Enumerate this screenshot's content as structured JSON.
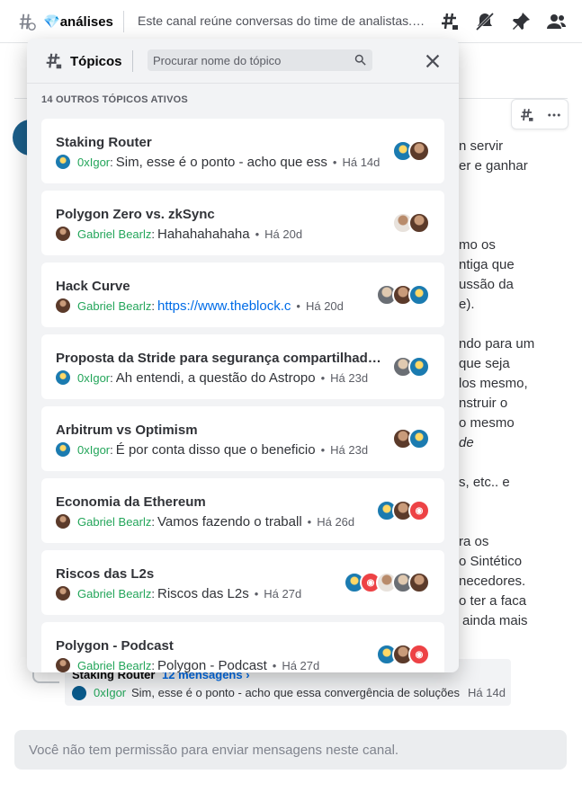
{
  "header": {
    "channel_prefix": "💎",
    "channel_name": "análises",
    "topic": "Este canal reúne conversas do time de analistas. Participe!"
  },
  "background": {
    "lines": [
      "n servir",
      "er e ganhar",
      "mo os",
      "ntiga que",
      "ussão da",
      "e).",
      "ndo para um",
      "que seja",
      "los mesmo,",
      "nstruir o",
      "o mesmo",
      "de",
      "s, etc.. e",
      "ra os",
      "o Sintético",
      "necedores.",
      "o ter a faca",
      "ainda mais"
    ]
  },
  "popup": {
    "title": "Tópicos",
    "search_placeholder": "Procurar nome do tópico",
    "section_label": "14 OUTROS TÓPICOS ATIVOS",
    "threads": [
      {
        "name": "Staking Router",
        "author": "0xIgor",
        "preview": "Sim, esse é o ponto - acho que ess",
        "time": "Há 14d",
        "is_link": false
      },
      {
        "name": "Polygon Zero vs. zkSync",
        "author": "Gabriel Bearlz",
        "preview": "Hahahahahaha",
        "time": "Há 20d",
        "is_link": false
      },
      {
        "name": "Hack Curve",
        "author": "Gabriel Bearlz",
        "preview": "https://www.theblock.c",
        "time": "Há 20d",
        "is_link": true
      },
      {
        "name": "Proposta da Stride para segurança compartilhada...",
        "author": "0xIgor",
        "preview": "Ah entendi, a questão do Astropo",
        "time": "Há 23d",
        "is_link": false
      },
      {
        "name": "Arbitrum vs Optimism",
        "author": "0xIgor",
        "preview": "É por conta disso que o beneficio",
        "time": "Há 23d",
        "is_link": false
      },
      {
        "name": "Economia da Ethereum",
        "author": "Gabriel Bearlz",
        "preview": "Vamos fazendo o traball",
        "time": "Há 26d",
        "is_link": false
      },
      {
        "name": "Riscos das L2s",
        "author": "Gabriel Bearlz",
        "preview": "Riscos das L2s",
        "time": "Há 27d",
        "is_link": false
      },
      {
        "name": "Polygon - Podcast",
        "author": "Gabriel Bearlz",
        "preview": "Polygon - Podcast",
        "time": "Há 27d",
        "is_link": false
      }
    ]
  },
  "thread_preview": {
    "title": "Staking Router",
    "count": "12 mensagens ›",
    "author": "0xIgor",
    "message": "Sim, esse é o ponto - acho que essa convergência de soluções",
    "time": "Há 14d"
  },
  "composer": {
    "placeholder": "Você não tem permissão para enviar mensagens neste canal."
  },
  "colors": {
    "author_green": "#23a55a",
    "link_blue": "#006ce7",
    "discord_red": "#ed4245"
  },
  "icons": [
    "threads-icon",
    "threads-icon",
    "mute-icon",
    "pin-icon",
    "members-icon",
    "more-icon",
    "search-icon",
    "close-icon"
  ]
}
